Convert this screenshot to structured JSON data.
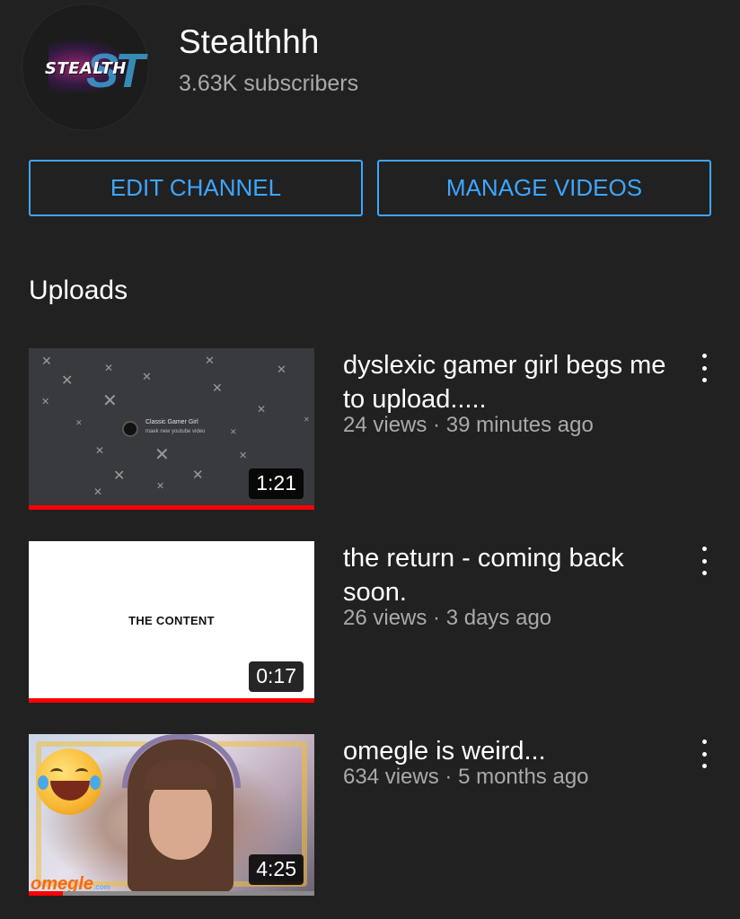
{
  "channel": {
    "avatar_text": "STEALTH",
    "avatar_mark": "ST",
    "name": "Stealthhh",
    "subscribers": "3.63K subscribers"
  },
  "actions": {
    "edit_label": "EDIT CHANNEL",
    "manage_label": "MANAGE VIDEOS"
  },
  "uploads": {
    "title": "Uploads",
    "videos": [
      {
        "title": "dyslexic gamer girl begs me to upload.....",
        "views": "24 views",
        "age": "39 minutes ago",
        "duration": "1:21",
        "thumb_text_1": "Classic Gamer Girl",
        "thumb_text_2": "maek new youtube video",
        "watched_fraction": 1.0
      },
      {
        "title": "the return - coming back soon.",
        "views": "26 views",
        "age": "3 days ago",
        "duration": "0:17",
        "thumb_text_1": "THE CONTENT",
        "watched_fraction": 1.0
      },
      {
        "title": "omegle is weird...",
        "views": "634 views",
        "age": "5 months ago",
        "duration": "4:25",
        "thumb_text_1": "omegle",
        "thumb_text_2": ".com",
        "watched_fraction": 0.12
      }
    ]
  },
  "colors": {
    "background": "#212121",
    "accent": "#3ea6ff",
    "progress": "#ff0000",
    "secondary_text": "#aaaaaa"
  },
  "icons": [
    "more-vert-icon"
  ]
}
